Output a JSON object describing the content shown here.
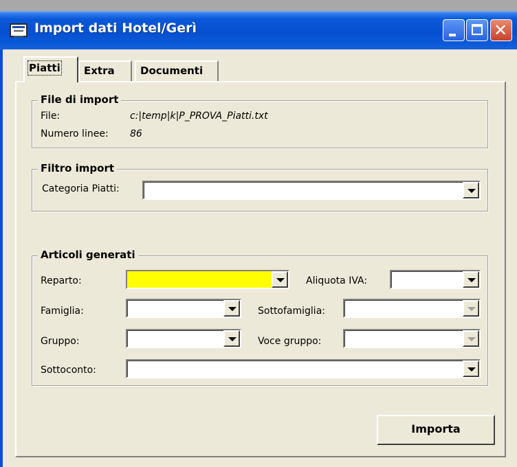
{
  "window": {
    "title": "Import dati Hotel/Gerì"
  },
  "tabs": [
    {
      "label": "Piatti",
      "active": true
    },
    {
      "label": "Extra",
      "active": false
    },
    {
      "label": "Documenti",
      "active": false
    }
  ],
  "file_group": {
    "title": "File di import",
    "file_label": "File:",
    "file_value": "c:|temp|k|P_PROVA_Piatti.txt",
    "lines_label": "Numero linee:",
    "lines_value": "86"
  },
  "filter_group": {
    "title": "Filtro import",
    "category_label": "Categoria Piatti:",
    "category_value": ""
  },
  "articles_group": {
    "title": "Articoli generati",
    "reparto_label": "Reparto:",
    "reparto_value": "",
    "aliquota_label": "Aliquota IVA:",
    "aliquota_value": "",
    "famiglia_label": "Famiglia:",
    "famiglia_value": "",
    "sottofamiglia_label": "Sottofamiglia:",
    "sottofamiglia_value": "",
    "gruppo_label": "Gruppo:",
    "gruppo_value": "",
    "voce_gruppo_label": "Voce gruppo:",
    "voce_gruppo_value": "",
    "sottoconto_label": "Sottoconto:",
    "sottoconto_value": ""
  },
  "actions": {
    "import_label": "Importa"
  },
  "colors": {
    "titlebar": "#0650d0",
    "highlight_field": "#ffff00",
    "face": "#ece9d8"
  }
}
